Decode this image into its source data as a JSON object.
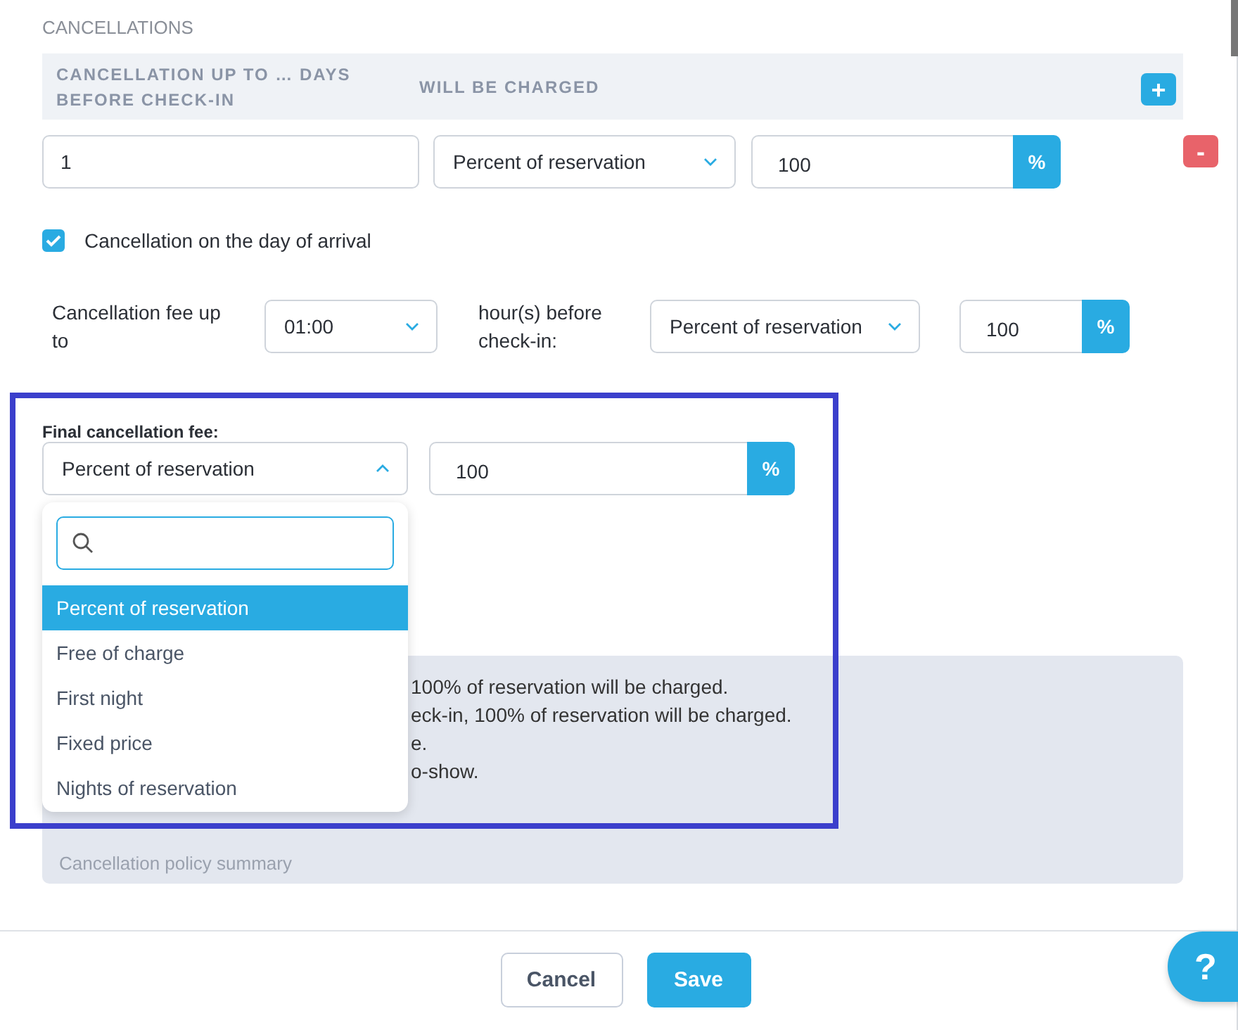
{
  "section_title": "CANCELLATIONS",
  "rules_table": {
    "columns": [
      "CANCELLATION UP TO … DAYS BEFORE CHECK-IN",
      "WILL BE CHARGED"
    ],
    "add_label": "+",
    "rows": [
      {
        "days": "1",
        "charge_type": "Percent of reservation",
        "amount": "100",
        "unit": "%",
        "remove_label": "-"
      }
    ]
  },
  "day_of_arrival": {
    "label": "Cancellation on the day of arrival",
    "checked": true,
    "fee_label": "Cancellation fee up to",
    "time": "01:00",
    "time_suffix": "hour(s) before check-in:",
    "charge_type": "Percent of reservation",
    "amount": "100",
    "unit": "%"
  },
  "final_fee": {
    "label": "Final cancellation fee:",
    "charge_type": "Percent of reservation",
    "expanded": true,
    "amount": "100",
    "unit": "%",
    "options": [
      {
        "label": "Percent of reservation",
        "selected": true
      },
      {
        "label": "Free of charge",
        "selected": false
      },
      {
        "label": "First night",
        "selected": false
      },
      {
        "label": "Fixed price",
        "selected": false
      },
      {
        "label": "Nights of reservation",
        "selected": false
      }
    ]
  },
  "summary": {
    "lines": [
      "100% of reservation will be charged.",
      "eck-in, 100% of reservation will be charged.",
      "e.",
      "o-show."
    ],
    "caption": "Cancellation policy summary"
  },
  "buttons": [
    {
      "label": "Cancel",
      "kind": "secondary"
    },
    {
      "label": "Save",
      "kind": "primary"
    }
  ],
  "help": {
    "label": "?"
  }
}
